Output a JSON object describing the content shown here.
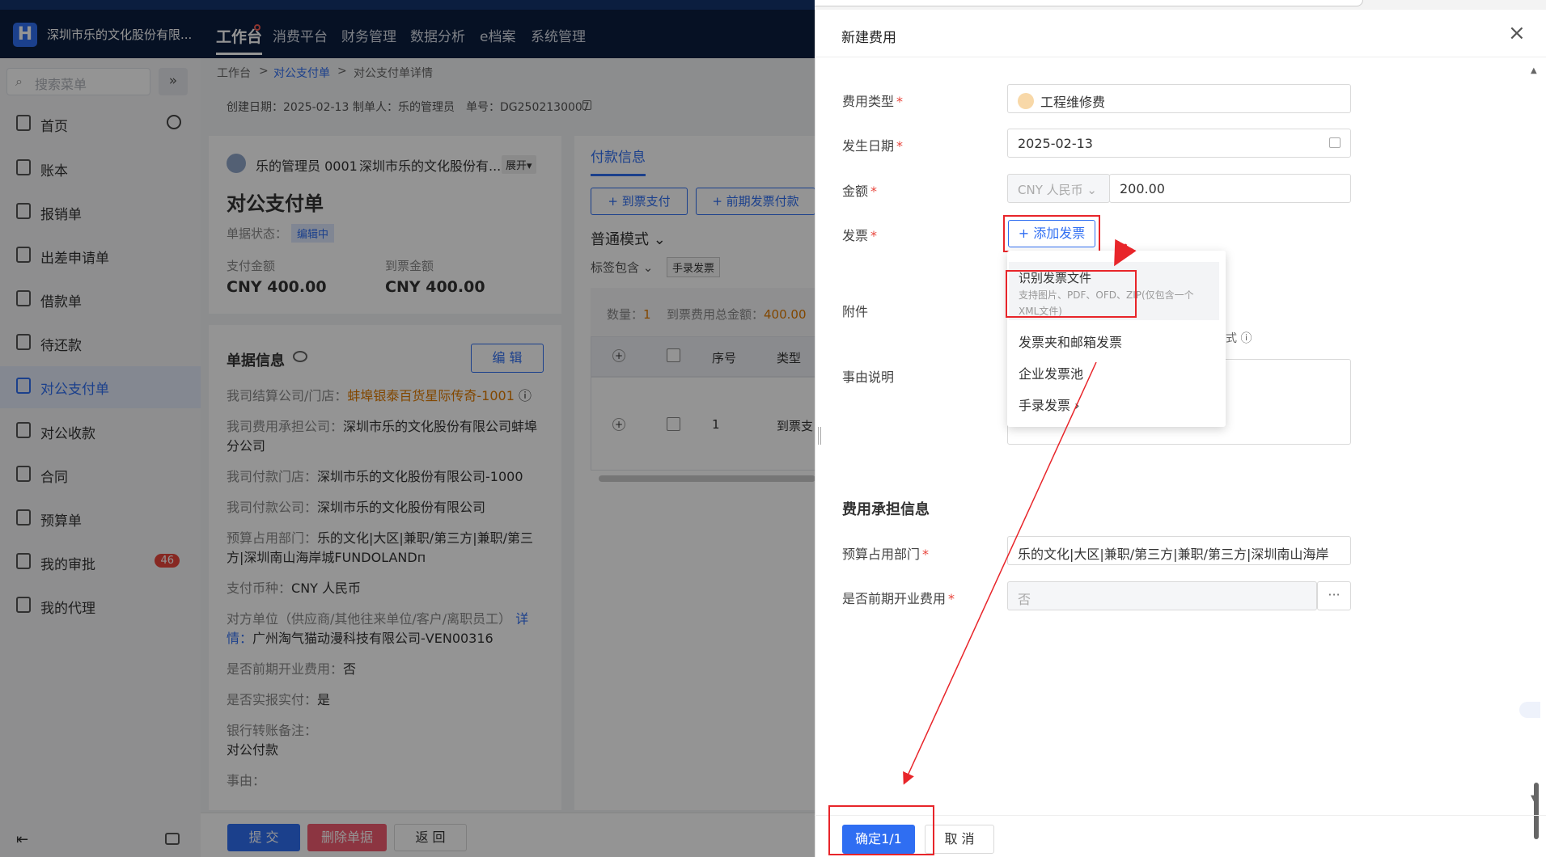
{
  "topbar": {
    "company": "深圳市乐的文化股份有限...",
    "nav": [
      "工作台",
      "消费平台",
      "财务管理",
      "数据分析",
      "e档案",
      "系统管理"
    ]
  },
  "sidebar": {
    "search_placeholder": "搜索菜单",
    "collapse_icon": "»",
    "items": [
      {
        "label": "首页"
      },
      {
        "label": "账本"
      },
      {
        "label": "报销单"
      },
      {
        "label": "出差申请单"
      },
      {
        "label": "借款单"
      },
      {
        "label": "待还款"
      },
      {
        "label": "对公支付单"
      },
      {
        "label": "对公收款"
      },
      {
        "label": "合同"
      },
      {
        "label": "预算单"
      },
      {
        "label": "我的审批",
        "badge": "46"
      },
      {
        "label": "我的代理"
      }
    ],
    "footer_left_icon": "⇤"
  },
  "breadcrumb": [
    "工作台",
    "对公支付单",
    "对公支付单详情"
  ],
  "breadcrumb_sep": ">",
  "meta": {
    "created": "创建日期：2025-02-13",
    "maker": "制单人：乐的管理员",
    "number": "单号：DG2502130007"
  },
  "summary": {
    "user": "乐的管理员 0001",
    "org": "深圳市乐的文化股份有...",
    "expand": "展开▾",
    "title": "对公支付单",
    "status_label": "单据状态：",
    "status": "编辑中",
    "pay_label": "支付金额",
    "pay_value": "CNY 400.00",
    "arrive_label": "到票金额",
    "arrive_value": "CNY 400.00"
  },
  "doc_info": {
    "title": "单据信息",
    "edit_btn": "编 辑",
    "rows": [
      {
        "k": "我司结算公司/门店：",
        "v": "蚌埠银泰百货星际传奇-1001"
      },
      {
        "k": "我司费用承担公司：",
        "v": "深圳市乐的文化股份有限公司蚌埠"
      },
      {
        "k": "",
        "v": "分公司"
      },
      {
        "k": "我司付款门店：",
        "v": "深圳市乐的文化股份有限公司-1000"
      },
      {
        "k": "我司付款公司：",
        "v": "深圳市乐的文化股份有限公司"
      },
      {
        "k": "预算占用部门：",
        "v": "乐的文化|大区|兼职/第三方|兼职/第三"
      },
      {
        "k": "",
        "v": "方|深圳南山海岸城FUNDOLANDп"
      },
      {
        "k": "支付币种：",
        "v": "CNY 人民币"
      },
      {
        "k": "对方单位（供应商/其他往来单位/客户/离职员工）",
        "v": "详"
      },
      {
        "k": "情：",
        "v": "广州淘气猫动漫科技有限公司-VEN00316"
      },
      {
        "k": "是否前期开业费用：",
        "v": "否"
      },
      {
        "k": "是否实报实付：",
        "v": "是"
      },
      {
        "k": "银行转账备注：",
        "v": ""
      },
      {
        "k": "",
        "v": "对公付款"
      },
      {
        "k": "事由：",
        "v": ""
      }
    ]
  },
  "pay_panel": {
    "tab": "付款信息",
    "btn1": "+ 到票支付",
    "btn2": "+ 前期发票付款",
    "mode": "普通模式 ⌄",
    "tag_filter": "标签包含 ⌄",
    "manual_tag": "手录发票",
    "count_label": "数量：",
    "count": "1",
    "total_label": "到票费用总金额：",
    "total": "400.00",
    "col_seq": "序号",
    "col_type": "类型",
    "row_seq": "1",
    "row_type": "到票支"
  },
  "bottom_bar": {
    "submit": "提 交",
    "delete": "删除单据",
    "back": "返 回"
  },
  "drawer": {
    "title": "新建费用",
    "close_icon": "×",
    "fields": {
      "type_label": "费用类型",
      "type_value": "工程维修费",
      "date_label": "发生日期",
      "date_value": "2025-02-13",
      "amount_label": "金额",
      "currency": "CNY 人民币 ⌄",
      "amount_value": "200.00",
      "invoice_label": "发票",
      "add_invoice": "+ 添加发票",
      "attach_label": "附件",
      "attach_hint": "式 ⓘ",
      "reason_label": "事由说明"
    },
    "dropdown": {
      "item1_title": "识别发票文件",
      "item1_desc1": "支持图片、PDF、OFD、ZIP(仅包含一个",
      "item1_desc2": "XML文件)",
      "item2": "发票夹和邮箱发票",
      "item3": "企业发票池",
      "item4": "手录发票 ›"
    },
    "section_title": "费用承担信息",
    "budget_label": "预算占用部门",
    "budget_value": "乐的文化|大区|兼职/第三方|兼职/第三方|深圳南山海岸",
    "preopen_label": "是否前期开业费用",
    "preopen_value": "否",
    "preopen_more": "···",
    "confirm": "确定1/1",
    "cancel": "取 消"
  },
  "colors": {
    "accent": "#2f6ef2",
    "annotation_red": "#e8252a",
    "topbar": "#0b1e3f"
  }
}
